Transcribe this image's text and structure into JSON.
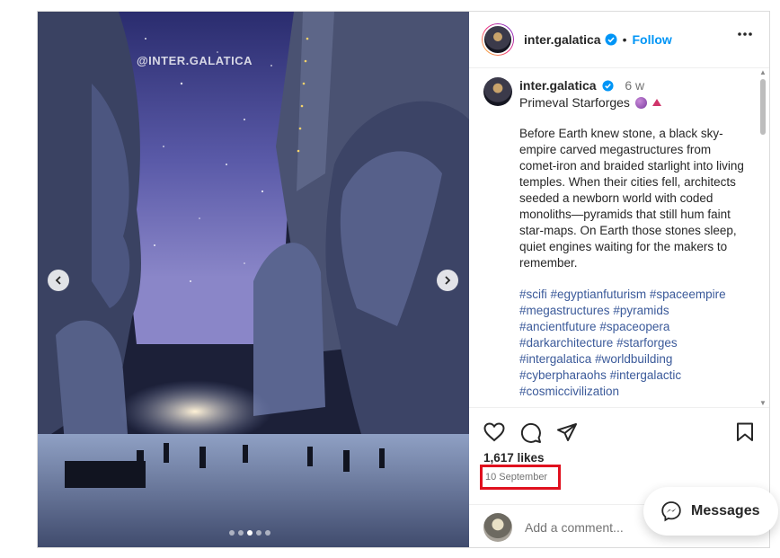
{
  "post": {
    "watermark": "@INTER.GALATICA",
    "carousel": {
      "total_slides": 5,
      "active_index": 2
    }
  },
  "header": {
    "username": "inter.galatica",
    "separator": "•",
    "follow_label": "Follow",
    "more_icon": "more-horizontal-icon"
  },
  "caption": {
    "username": "inter.galatica",
    "time": "6 w",
    "title": "Primeval Starforges",
    "body": "Before Earth knew stone, a black sky-empire carved megastructures from comet-iron and braided starlight into living temples. When their cities fell, architects seeded a newborn world with coded monoliths—pyramids that still hum faint star-maps. On Earth those stones sleep, quiet engines waiting for the makers to remember.",
    "hashtags": [
      "#scifi",
      "#egyptianfuturism",
      "#spaceempire",
      "#megastructures",
      "#pyramids",
      "#ancientfuture",
      "#spaceopera",
      "#darkarchitecture",
      "#starforges",
      "#intergalatica",
      "#worldbuilding",
      "#cyberpharaohs",
      "#intergalactic",
      "#cosmiccivilization"
    ]
  },
  "actions": {
    "like_icon": "heart-icon",
    "comment_icon": "comment-icon",
    "share_icon": "send-icon",
    "save_icon": "bookmark-icon"
  },
  "likes": "1,617 likes",
  "date": "10 September",
  "comment": {
    "placeholder": "Add a comment..."
  },
  "messages": {
    "label": "Messages"
  },
  "colors": {
    "accent": "#0095f6",
    "hashtag": "#3b5a9a",
    "highlight_box": "#e0101e"
  }
}
